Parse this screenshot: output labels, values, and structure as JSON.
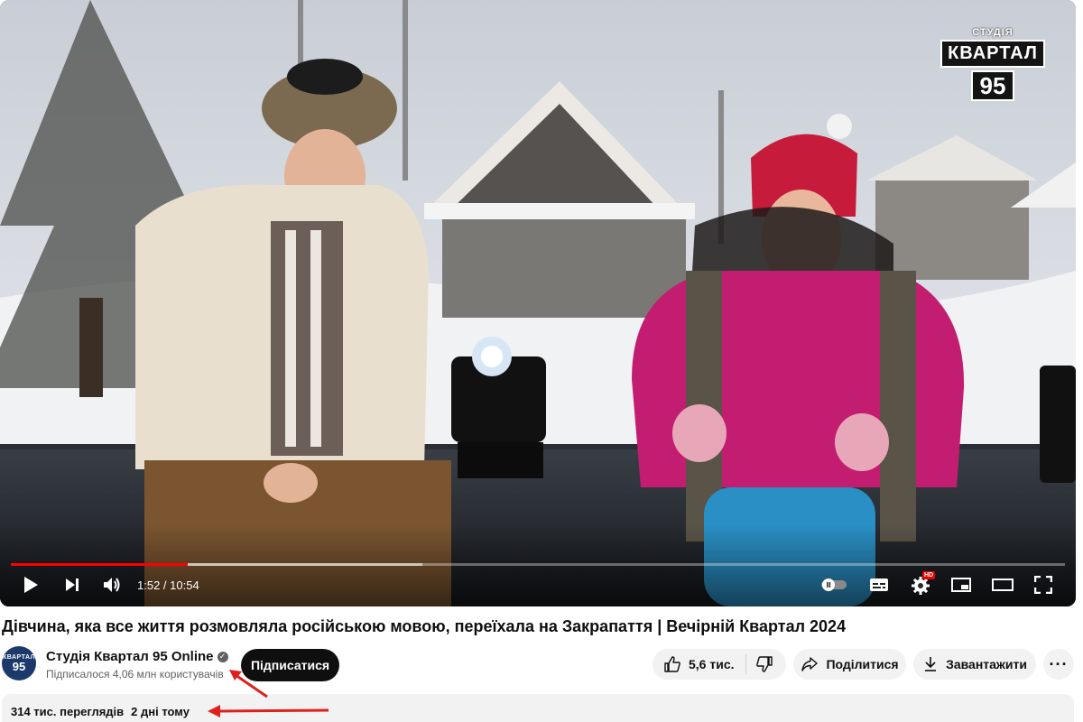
{
  "player": {
    "logo": {
      "top": "СТУДІЯ",
      "middle": "КВАРТАЛ",
      "number": "95"
    },
    "progress_played_fraction": 0.168,
    "progress_buffered_fraction": 0.39,
    "time_display": "1:52 / 10:54",
    "settings_badge": "HD",
    "icons": [
      "play-icon",
      "next-icon",
      "volume-icon",
      "autoplay-toggle-icon",
      "subtitles-icon",
      "settings-icon",
      "miniplayer-icon",
      "theater-icon",
      "fullscreen-icon"
    ],
    "progress_color": "#ff0000"
  },
  "video": {
    "title": "Дівчина, яка все життя розмовляла російською мовою, переїхала на Закрапаття | Вечірній Квартал 2024"
  },
  "channel": {
    "avatar": {
      "top": "КВАРТАЛ",
      "number": "95"
    },
    "name": "Студія Квартал 95 Online",
    "verified_mark": "✓",
    "subscribers": "Підписалося 4,06 млн користувачів",
    "subscribe_label": "Підписатися"
  },
  "actions": {
    "likes": "5,6 тис.",
    "share_label": "Поділитися",
    "download_label": "Завантажити",
    "more_label": "···"
  },
  "description": {
    "views": "314 тис. переглядів",
    "date": "2 дні тому"
  },
  "annotation_color": "#e0201c"
}
